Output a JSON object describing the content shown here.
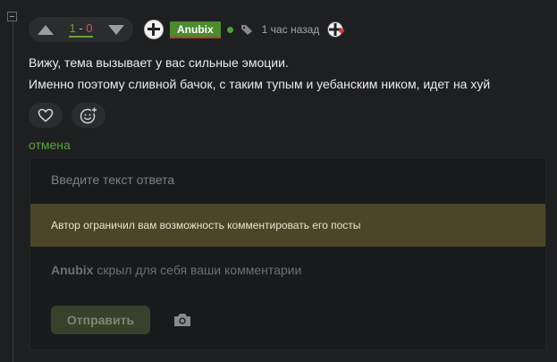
{
  "comment": {
    "rating": {
      "plus": "1",
      "sep": " - ",
      "minus": "0"
    },
    "author": "Anubix",
    "time": "1 час назад",
    "body_lines": [
      "Вижу, тема вызывает у вас сильные эмоции.",
      "Именно поэтому сливной бачок, с таким тупым и уебанским ником, идет на хуй"
    ]
  },
  "actions": {
    "cancel_label": "отмена"
  },
  "reply": {
    "placeholder": "Введите текст ответа",
    "restriction_notice": "Автор ограничил вам возможность комментировать его посты",
    "hidden_user": "Anubix",
    "hidden_text": " скрыл для себя ваши комментарии",
    "send_label": "Отправить"
  },
  "icons": {
    "upvote": "triangle-up-icon",
    "downvote": "triangle-down-icon",
    "like": "heart-icon",
    "emoji": "emoji-add-icon",
    "tag": "tag-icon",
    "camera": "camera-icon"
  },
  "colors": {
    "accent_green": "#5da13a",
    "username_bg": "#4c8b2e",
    "notice_bg": "#4b4529"
  }
}
